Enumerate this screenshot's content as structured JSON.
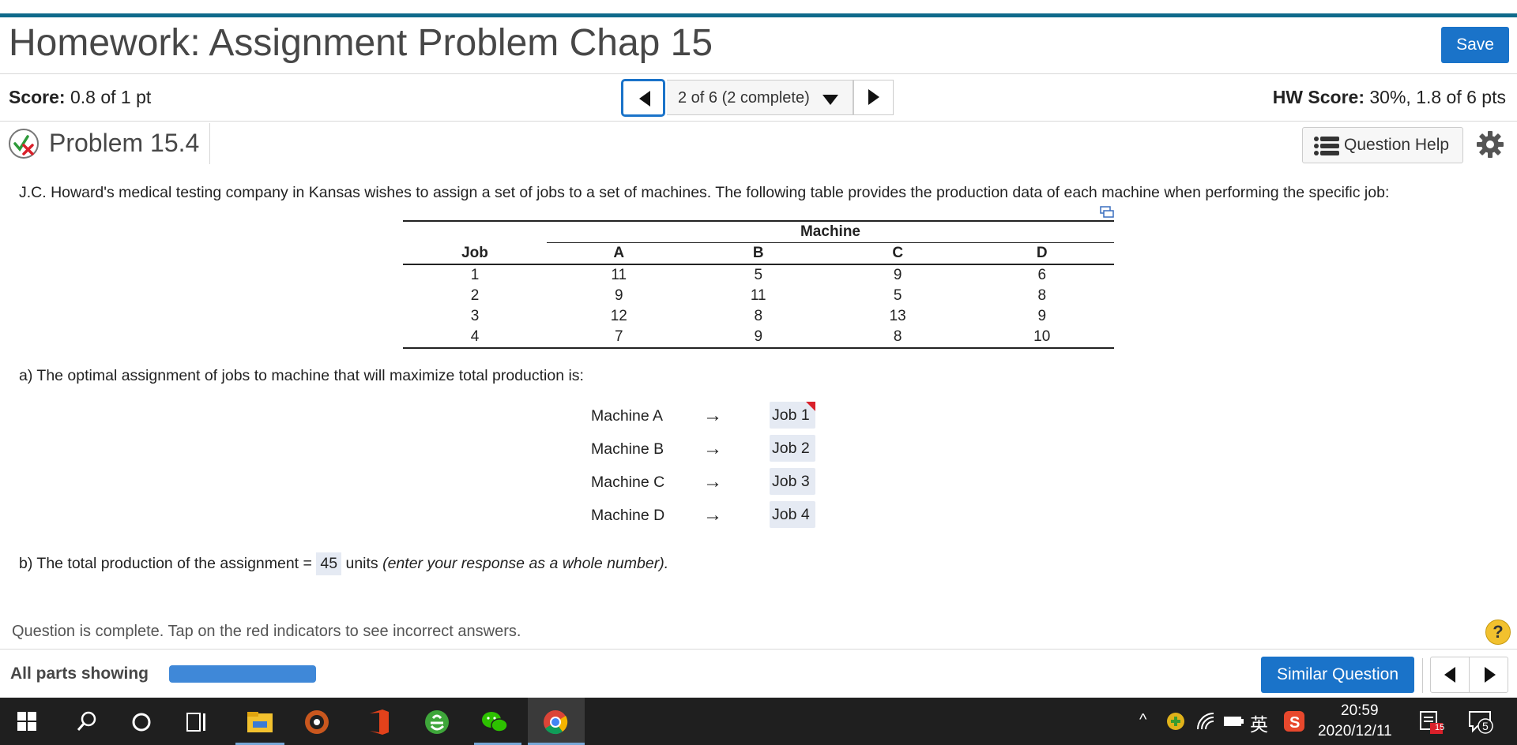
{
  "header": {
    "title": "Homework: Assignment Problem Chap 15",
    "save_label": "Save"
  },
  "score": {
    "label": "Score:",
    "value": "0.8 of 1 pt"
  },
  "hw_score": {
    "label": "HW Score:",
    "value": "30%, 1.8 of 6 pts"
  },
  "nav": {
    "selector_text": "2 of 6 (2 complete)"
  },
  "problem": {
    "title": "Problem 15.4",
    "help_label": "Question Help"
  },
  "question": {
    "text": "J.C. Howard's medical testing company in Kansas wishes to assign a set of jobs to a set of machines. The following table provides the production data of each machine when performing the specific job:"
  },
  "table": {
    "group_header": "Machine",
    "row_header": "Job",
    "columns": [
      "A",
      "B",
      "C",
      "D"
    ],
    "rows": [
      [
        "1",
        "11",
        "5",
        "9",
        "6"
      ],
      [
        "2",
        "9",
        "11",
        "5",
        "8"
      ],
      [
        "3",
        "12",
        "8",
        "13",
        "9"
      ],
      [
        "4",
        "7",
        "9",
        "8",
        "10"
      ]
    ]
  },
  "part_a": {
    "text": "a) The optimal assignment of jobs to machine that will maximize total production is:",
    "arrow": "→",
    "assignments": [
      {
        "machine": "Machine A",
        "job": "Job 1",
        "flagged": true
      },
      {
        "machine": "Machine B",
        "job": "Job 2",
        "flagged": false
      },
      {
        "machine": "Machine C",
        "job": "Job 3",
        "flagged": false
      },
      {
        "machine": "Machine D",
        "job": "Job 4",
        "flagged": false
      }
    ]
  },
  "part_b": {
    "prefix": "b) The total production of the assignment =",
    "value": "45",
    "units": "units",
    "hint": "(enter your response as a whole number)."
  },
  "status": {
    "message": "Question is complete. Tap on the red indicators to see incorrect answers.",
    "help_glyph": "?"
  },
  "footer": {
    "all_parts_label": "All parts showing",
    "progress": 1.0,
    "similar_label": "Similar Question"
  },
  "taskbar": {
    "time": "20:59",
    "date": "2020/12/11",
    "ime": "英",
    "notification_count": "5",
    "calendar_badge": "15"
  },
  "colors": {
    "accent": "#1a73c9",
    "topbar": "#0f6a8b",
    "answer_bg": "#e5eaf3",
    "flag": "#d9202a"
  }
}
